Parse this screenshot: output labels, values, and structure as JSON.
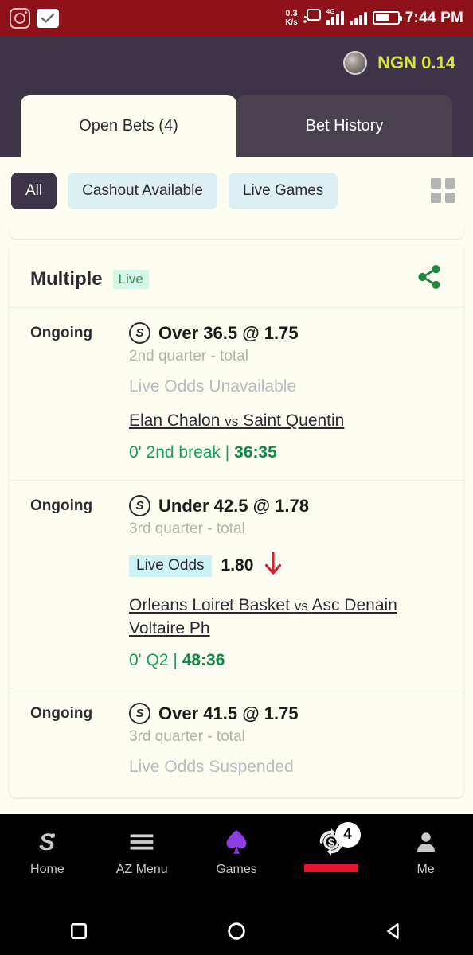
{
  "statusbar": {
    "instagram_icon": "instagram-icon",
    "check_icon": "check-icon",
    "net_speed_value": "0.3",
    "net_speed_unit": "K/s",
    "cast_icon": "cast-icon",
    "signal_4g_label": "4G",
    "battery_icon": "battery-icon",
    "time": "7:44 PM"
  },
  "appbar": {
    "avatar": "user-avatar",
    "balance": "NGN 0.14",
    "balance_color": "#d9e33a"
  },
  "tabs": [
    {
      "label": "Open Bets (4)",
      "active": true
    },
    {
      "label": "Bet History",
      "active": false
    }
  ],
  "filters": {
    "chips": [
      {
        "label": "All",
        "selected": true
      },
      {
        "label": "Cashout Available",
        "selected": false
      },
      {
        "label": "Live Games",
        "selected": false
      }
    ],
    "grid_icon": "grid-view-icon"
  },
  "card": {
    "title": "Multiple",
    "live_badge": "Live",
    "share_icon": "share-icon",
    "selections": [
      {
        "status": "Ongoing",
        "coin_icon": "coin-s-icon",
        "pick": "Over 36.5 @ 1.75",
        "market": "2nd quarter - total",
        "odds_state": "unavailable",
        "odds_note": "Live Odds Unavailable",
        "odds_chip": "",
        "odds_value": "",
        "teams_home": "Elan Chalon",
        "teams_vs": "vs",
        "teams_away": "Saint Quentin",
        "match_time": "0' 2nd break",
        "match_score": "36:35"
      },
      {
        "status": "Ongoing",
        "coin_icon": "coin-s-icon",
        "pick": "Under 42.5 @ 1.78",
        "market": "3rd quarter - total",
        "odds_state": "available",
        "odds_note": "",
        "odds_chip": "Live Odds",
        "odds_value": "1.80",
        "odds_trend": "down",
        "teams_home": "Orleans Loiret Basket",
        "teams_vs": "vs",
        "teams_away": "Asc Denain Voltaire Ph",
        "match_time": "0' Q2",
        "match_score": "48:36"
      },
      {
        "status": "Ongoing",
        "coin_icon": "coin-s-icon",
        "pick": "Over 41.5 @ 1.75",
        "market": "3rd quarter - total",
        "odds_state": "suspended",
        "odds_note": "Live Odds Suspended",
        "odds_chip": "",
        "odds_value": "",
        "teams_home": "",
        "teams_vs": "",
        "teams_away": "",
        "match_time": "",
        "match_score": ""
      }
    ]
  },
  "bottomnav": {
    "items": [
      {
        "label": "Home",
        "icon": "home-dollar-icon"
      },
      {
        "label": "AZ Menu",
        "icon": "hamburger-menu-icon"
      },
      {
        "label": "Games",
        "icon": "spade-icon"
      },
      {
        "label": "",
        "icon": "cashout-icon",
        "badge": "4",
        "active": true
      },
      {
        "label": "Me",
        "icon": "person-icon"
      }
    ]
  },
  "androidnav": {
    "recents_icon": "recents-square-icon",
    "home_icon": "home-circle-icon",
    "back_icon": "back-triangle-icon"
  }
}
